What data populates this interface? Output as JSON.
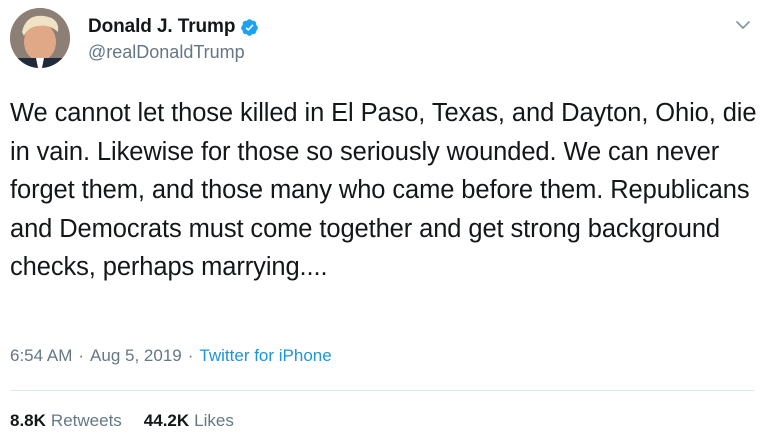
{
  "user": {
    "display_name": "Donald J. Trump",
    "handle": "@realDonaldTrump",
    "verified": true
  },
  "tweet": {
    "text": "We cannot let those killed in El Paso, Texas, and Dayton, Ohio, die in vain. Likewise for those so seriously wounded. We can never forget them, and those many who came before them. Republicans and Democrats must come together and get strong background checks, perhaps marrying....",
    "time": "6:54 AM",
    "date": "Aug 5, 2019",
    "separator": "·",
    "source": "Twitter for iPhone"
  },
  "stats": {
    "retweets_count": "8.8K",
    "retweets_label": "Retweets",
    "likes_count": "44.2K",
    "likes_label": "Likes"
  },
  "icons": {
    "verified": "verified-badge-icon",
    "menu": "chevron-down-icon"
  },
  "colors": {
    "text": "#14171a",
    "secondary": "#657786",
    "link": "#1b95e0",
    "verified": "#1da1f2"
  }
}
